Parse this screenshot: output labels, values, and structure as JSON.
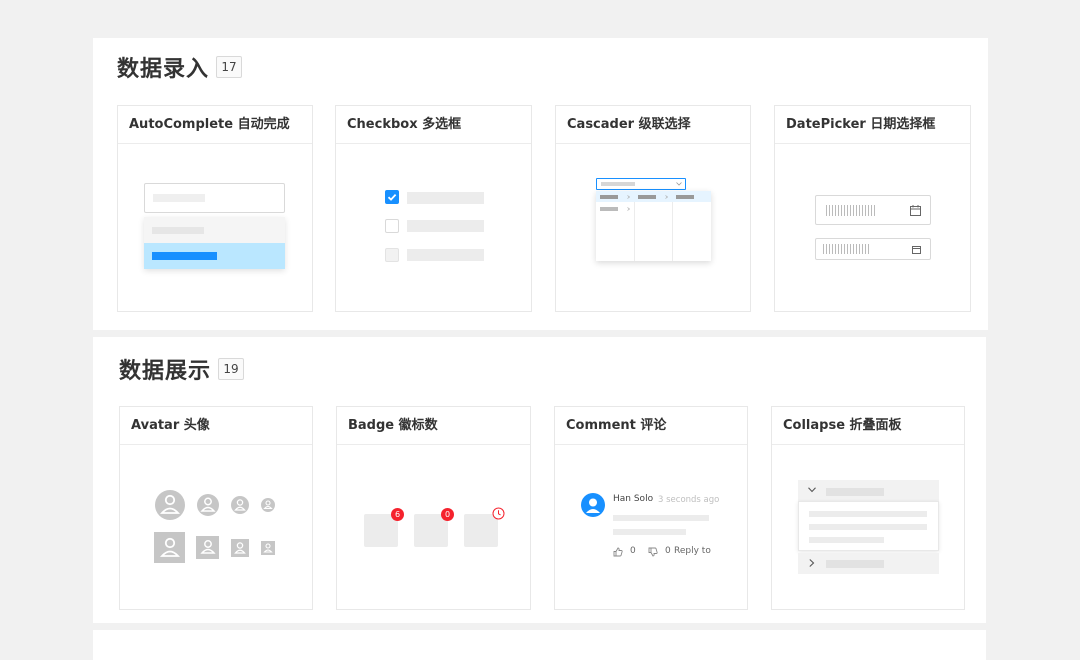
{
  "sections": [
    {
      "title": "数据录入",
      "count": "17",
      "cards": [
        {
          "title": "AutoComplete 自动完成"
        },
        {
          "title": "Checkbox 多选框"
        },
        {
          "title": "Cascader 级联选择"
        },
        {
          "title": "DatePicker 日期选择框"
        }
      ]
    },
    {
      "title": "数据展示",
      "count": "19",
      "cards": [
        {
          "title": "Avatar 头像"
        },
        {
          "title": "Badge 徽标数"
        },
        {
          "title": "Comment 评论"
        },
        {
          "title": "Collapse 折叠面板"
        }
      ]
    }
  ],
  "badge": {
    "count_a": "6",
    "count_b": "0"
  },
  "comment": {
    "author": "Han Solo",
    "time": "3 seconds ago",
    "likes": "0",
    "dislikes": "0",
    "reply": "Reply to"
  },
  "colors": {
    "primary": "#1890ff",
    "danger": "#f5222d",
    "highlight": "#bae7ff"
  },
  "icons": [
    "checkbox-checked-icon",
    "user-icon",
    "calendar-icon",
    "clock-icon",
    "like-icon",
    "dislike-icon",
    "chevron-down-icon",
    "chevron-right-icon",
    "dropdown-arrow-icon"
  ]
}
